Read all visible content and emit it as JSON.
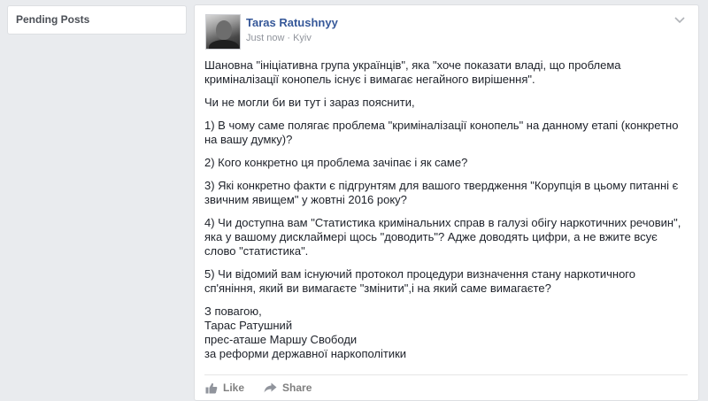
{
  "sidebar": {
    "items": [
      {
        "label": "Pending Posts"
      }
    ]
  },
  "post": {
    "author": "Taras Ratushnyy",
    "time": "Just now",
    "separator": "·",
    "location": "Kyiv",
    "paragraphs": [
      "Шановна \"ініціативна група українців\", яка \"хоче показати владі, що проблема криміналізації конопель існує і вимагає негайного вирішення\".",
      "Чи не могли би ви тут і зараз пояснити,",
      "1) В чому саме полягає проблема \"криміналізації конопель\" на данному етапі (конкретно на вашу думку)?",
      "2) Кого конкретно ця проблема зачіпає і як саме?",
      "3) Які конкретно факти є підгрунтям для вашого твердження \"Корупція в цьому питанні є звичним явищем\" у жовтні 2016 року?",
      "4) Чи доступна вам \"Статистика кримінальних справ в галузі обігу наркотичних речовин\", яка у вашому дисклаймері щось \"доводить\"? Адже доводять цифри, а не вжите всує слово \"статистика\".",
      "5) Чи відомий вам існуючий протокол процедури визначення стану наркотичного сп'яніння, який ви вимагаєте \"змінити\",і на який саме вимагаєте?"
    ],
    "signature": [
      "З повагою,",
      "Тарас Ратушний",
      "прес-аташе Маршу Свободи",
      "за реформи державної наркополітики"
    ],
    "actions": {
      "like_label": "Like",
      "share_label": "Share"
    }
  },
  "colors": {
    "background": "#e9ebee",
    "author_link": "#365899",
    "meta_text": "#90949c",
    "body_text": "#1d2129"
  },
  "icons": [
    "avatar",
    "chevron-down-icon",
    "like-icon",
    "share-icon"
  ]
}
